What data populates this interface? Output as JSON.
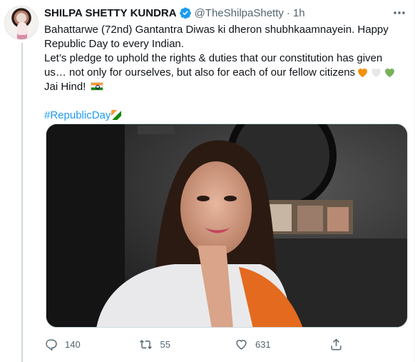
{
  "tweet": {
    "author": {
      "name": "SHILPA SHETTY KUNDRA",
      "handle": "@TheShilpaShetty",
      "separator": "·",
      "time": "1h",
      "verified": true,
      "verified_color": "#1d9bf0"
    },
    "text": {
      "line1": "Bahattarwe (72nd) Gantantra Diwas ki dheron shubhkaamnayein. Happy Republic Day to every Indian.",
      "line2": "Let’s pledge to uphold the rights & duties that our constitution has given us… not only for ourselves, but also for each of our fellow citizens",
      "line3": "Jai Hind!",
      "hashtag": "#RepublicDay",
      "heart_colors": [
        "#f4900c",
        "#e6e8ea",
        "#78b159"
      ]
    },
    "media": {
      "type": "video thumbnail"
    },
    "actions": {
      "reply_count": "140",
      "retweet_count": "55",
      "like_count": "631"
    },
    "icons": {
      "more": "more-icon",
      "reply": "reply-icon",
      "retweet": "retweet-icon",
      "like": "like-icon",
      "share": "share-icon"
    }
  }
}
